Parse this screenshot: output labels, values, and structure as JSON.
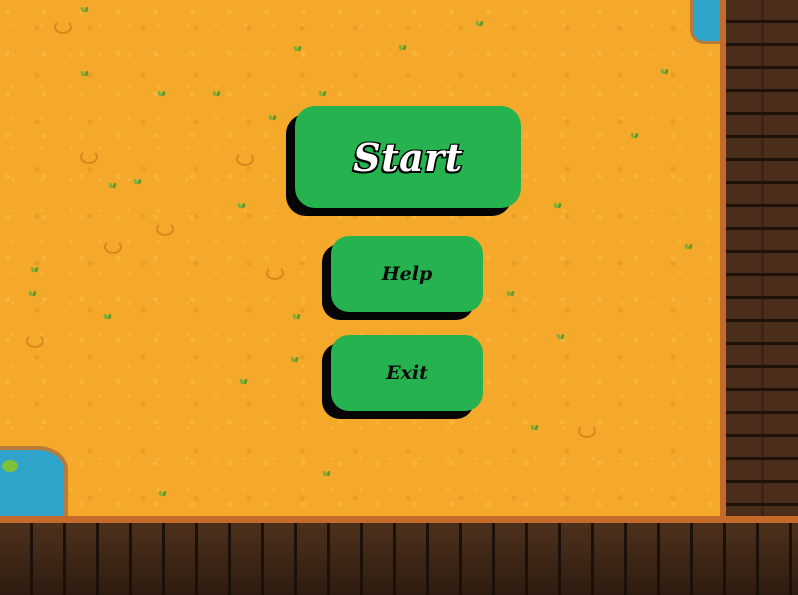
{
  "menu": {
    "start_label": "Start",
    "help_label": "Help",
    "exit_label": "Exit"
  },
  "colors": {
    "sand": "#f4a92a",
    "button_green": "#25b24f",
    "button_shadow": "#050505",
    "wood_dark": "#3a2314",
    "wood_trim": "#c46a2a",
    "water": "#2fa3c9"
  }
}
